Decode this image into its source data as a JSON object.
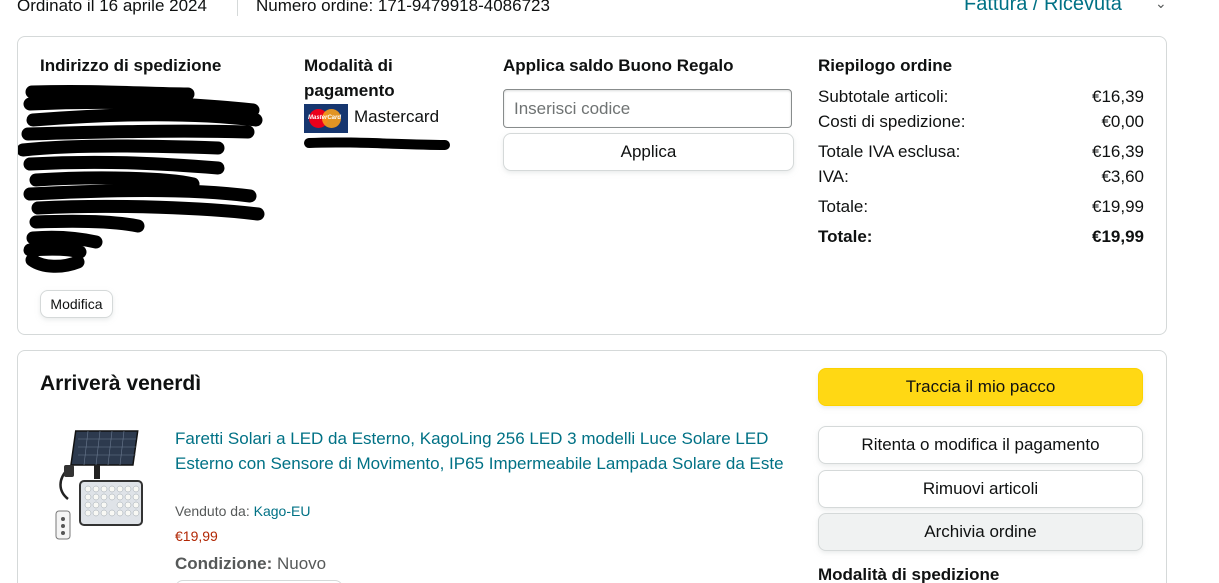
{
  "top": {
    "order_date": "Ordinato il 16 aprile 2024",
    "order_number": "Numero ordine: 171-9479918-4086723",
    "invoice_link": "Fattura / Ricevuta"
  },
  "address": {
    "title": "Indirizzo di spedizione",
    "edit_label": "Modifica"
  },
  "payment": {
    "title": "Modalità di pagamento",
    "card_name": "Mastercard",
    "logo_text": "MasterCard"
  },
  "gift": {
    "title": "Applica saldo Buono Regalo",
    "placeholder": "Inserisci codice",
    "apply_label": "Applica"
  },
  "summary": {
    "title": "Riepilogo ordine",
    "rows": [
      {
        "label": "Subtotale articoli:",
        "value": "€16,39"
      },
      {
        "label": "Costi di spedizione:",
        "value": "€0,00"
      },
      {
        "label": "Totale IVA esclusa:",
        "value": "€16,39"
      },
      {
        "label": "IVA:",
        "value": "€3,60"
      },
      {
        "label": "Totale:",
        "value": "€19,99"
      },
      {
        "label": "Totale:",
        "value": "€19,99"
      }
    ]
  },
  "shipment": {
    "arrival": "Arriverà venerdì",
    "product": {
      "title": "Faretti Solari a LED da Esterno, KagoLing 256 LED 3 modelli Luce Solare LED Esterno con Sensore di Movimento, IP65 Impermeabile Lampada Solare da Este",
      "sold_by_label": "Venduto da:",
      "seller": "Kago-EU",
      "price": "€19,99",
      "condition_label": "Condizione:",
      "condition_value": "Nuovo"
    },
    "actions": {
      "track": "Traccia il mio pacco",
      "retry_payment": "Ritenta o modifica il pagamento",
      "remove_items": "Rimuovi articoli",
      "archive": "Archivia ordine"
    },
    "shipping_method_title": "Modalità di spedizione"
  },
  "icons": {
    "dropdown": "chevron-down-icon",
    "card": "mastercard-logo-icon",
    "product": "solar-light-product-image"
  }
}
